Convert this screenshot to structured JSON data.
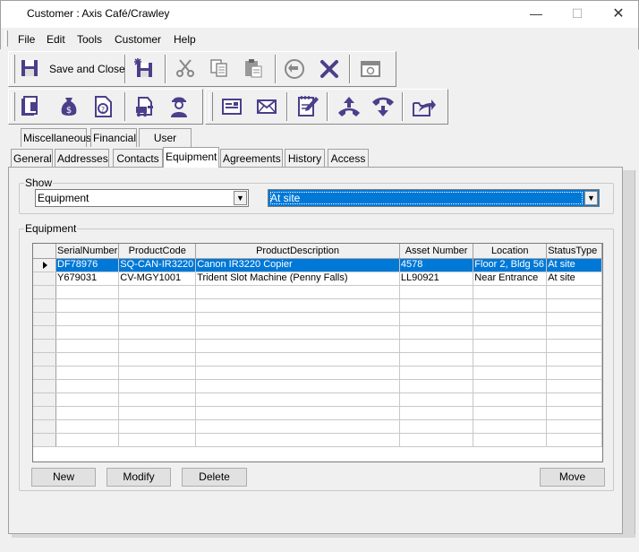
{
  "window": {
    "title": "Customer : Axis Café/Crawley",
    "minimize": "—",
    "maximize": "☐",
    "close": "✕"
  },
  "menu": [
    "File",
    "Edit",
    "Tools",
    "Customer",
    "Help"
  ],
  "toolbar1": {
    "save_close_label": "Save and Close"
  },
  "tabs_top": [
    "Miscellaneous",
    "Financial",
    "User Data"
  ],
  "tabs_bottom": [
    "General",
    "Addresses",
    "Contacts",
    "Equipment",
    "Agreements",
    "History",
    "Access"
  ],
  "active_tab": "Equipment",
  "show": {
    "legend": "Show",
    "type_value": "Equipment",
    "status_value": "At site"
  },
  "equipment": {
    "legend": "Equipment",
    "columns": [
      "SerialNumber",
      "ProductCode",
      "ProductDescription",
      "Asset Number",
      "Location",
      "StatusType"
    ],
    "rows": [
      [
        "DF78976",
        "SQ-CAN-IR3220",
        "Canon IR3220 Copier",
        "4578",
        "Floor 2, Bldg 56",
        "At site"
      ],
      [
        "Y679031",
        "CV-MGY1001",
        "Trident Slot Machine (Penny Falls)",
        "LL90921",
        "Near Entrance",
        "At site"
      ]
    ]
  },
  "buttons": {
    "new": "New",
    "modify": "Modify",
    "delete": "Delete",
    "move": "Move"
  },
  "colors": {
    "selection": "#0078d7",
    "icon_purple": "#4b3f8a"
  }
}
